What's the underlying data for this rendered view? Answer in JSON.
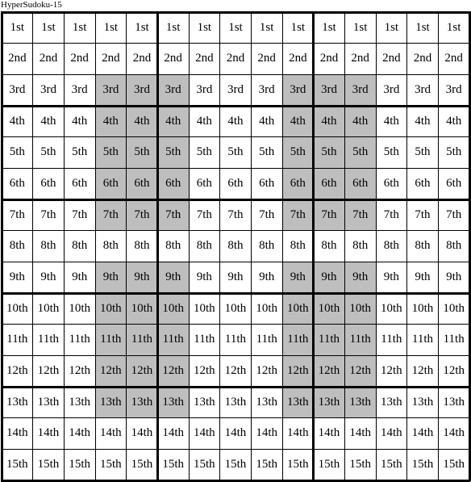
{
  "title": "HyperSudoku-15",
  "grid": {
    "size": 15,
    "box_cols": 5,
    "box_rows": 3,
    "shade_color": "#bebebe",
    "row_labels": [
      "1st",
      "2nd",
      "3rd",
      "4th",
      "5th",
      "6th",
      "7th",
      "8th",
      "9th",
      "10th",
      "11th",
      "12th",
      "13th",
      "14th",
      "15th"
    ],
    "shaded_rows": [
      3,
      4,
      5,
      6,
      7,
      9,
      10,
      11,
      12,
      13
    ],
    "shaded_cols": [
      4,
      5,
      6,
      10,
      11,
      12
    ]
  }
}
